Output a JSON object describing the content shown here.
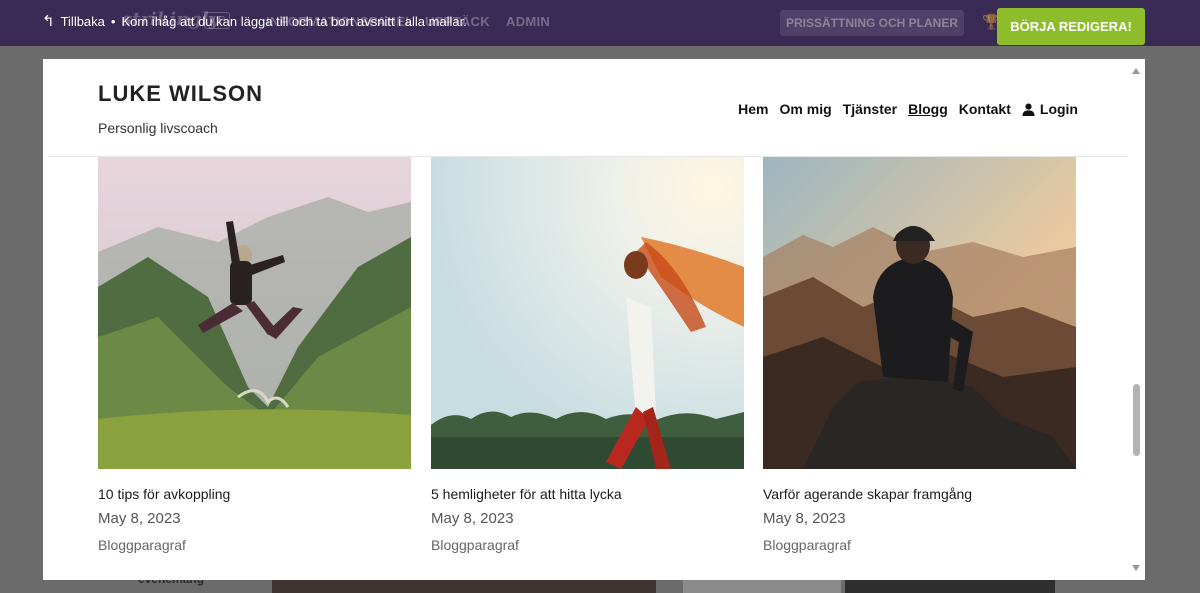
{
  "topbar": {
    "back_label": "Tillbaka",
    "separator": "•",
    "notice": "Kom ihåg att du kan lägga till och ta bort avsnitt i alla mallar.",
    "logo_text": "strikingly",
    "vip_badge": "VIP",
    "nav_dashboard": "INFORMATIONSPANEL",
    "nav_discover": "UPPTÄCK",
    "nav_admin": "ADMIN",
    "pricing_label": "PRISSÄTTNING OCH PLANER",
    "edit_button": "BÖRJA REDIGERA!",
    "edit_color": "#8dbd2a",
    "bar_color": "#3a2b55"
  },
  "background_page": {
    "partial_text": "evenemang"
  },
  "site": {
    "title": "LUKE WILSON",
    "subtitle": "Personlig livscoach",
    "nav": [
      {
        "label": "Hem",
        "active": false
      },
      {
        "label": "Om mig",
        "active": false
      },
      {
        "label": "Tjänster",
        "active": false
      },
      {
        "label": "Blogg",
        "active": true
      },
      {
        "label": "Kontakt",
        "active": false
      },
      {
        "label": "Login",
        "icon": "user-icon"
      }
    ]
  },
  "posts": [
    {
      "title": "10 tips för avkoppling",
      "date": "May 8, 2023",
      "paragraph": "Bloggparagraf",
      "image": "mountain-jump-photo"
    },
    {
      "title": "5 hemligheter för att hitta lycka",
      "date": "May 8, 2023",
      "paragraph": "Bloggparagraf",
      "image": "sunset-dancer-photo"
    },
    {
      "title": "Varför agerande skapar framgång",
      "date": "May 8, 2023",
      "paragraph": "Bloggparagraf",
      "image": "mountain-sitter-photo"
    }
  ]
}
